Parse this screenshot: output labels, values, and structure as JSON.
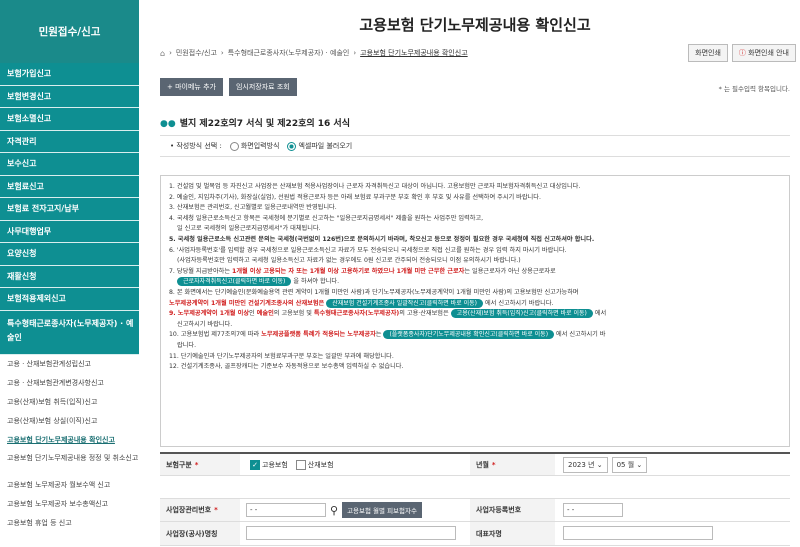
{
  "sidebar": {
    "title": "민원접수/신고",
    "items": [
      "보험가입신고",
      "보험변경신고",
      "보험소멸신고",
      "자격관리",
      "보수신고",
      "보험료신고",
      "보험료 전자고지/납부",
      "사무대행업무",
      "요양신청",
      "재활신청",
      "보험적용제외신고",
      "특수형태근로종사자(노무제공자) · 예술인"
    ],
    "subitems": [
      "고용 · 산재보험관계성립신고",
      "고용 · 산재보험관계변경사항신고",
      "고용(산재)보험 취득(입직)신고",
      "고용(산재)보험 상실(이직)신고",
      "고용보험 단기노무제공내용 확인신고",
      "고용보험 단기노무제공내용 정정 및 취소신고",
      "고용보험 노무제공자 월보수액 신고",
      "고용보험 노무제공자 보수총액신고",
      "고용보험 휴업 등 신고"
    ]
  },
  "header": {
    "title": "고용보험 단기노무제공내용 확인신고",
    "breadcrumb": [
      "민원접수/신고",
      "특수형태근로종사자(노무제공자) · 예술인",
      "고용보험 단기노무제공내용 확인신고"
    ],
    "print_label": "화면인쇄",
    "guide_label": "화면인쇄 안내"
  },
  "toolbar": {
    "add_menu": "+ 마이메뉴 추가",
    "temp_load": "임시저장자료 조회",
    "required_note": "* 는 필수입력 항목입니다."
  },
  "section": {
    "title": "별지 제22호의7 서식 및 제22호의 16 서식",
    "mode_label": "• 작성방식 선택 :",
    "mode_screen": "화면입력방식",
    "mode_excel": "엑셀파일 불러오기"
  },
  "notice": {
    "l1": "1. 건설업 및 벌목업 등 자진신고 사업장은 산재보험 적용사업장이나 근로자 자격취득신고 대상이 아닙니다. 고용보험만 근로자 피보험자격취득신고 대상입니다.",
    "l2": "2. 예술인, 지입차주(기사), 화장실(실업), 선원법 적용근로자 등은 아래 보험료 부과구분 부호 확인 후 부호 및 사유를 선택하여 주시기 바랍니다.",
    "l3": "3. 산재보험은 관리번호, 신고월별로 일용근로내역만 반영됩니다.",
    "l4": "4. 국세청 일용근로소득신고 항목은 국세청에 분기별로 신고하는 \"일용근로지급명세서\" 제출을 원하는 사업주만 입력하고,",
    "l4b": "일 신고로 국세청의 일용근로지급명세서\"가 대체됩니다.",
    "l5a": "5. 국세청 일용근로소득 신고관련 문의는 국세청(국번없이 126번)으로 문의하시기 바라며, 착오신고 등으로 정정이 필요한 경우 국세청에 직접 신고하셔야 합니다.",
    "l6": "6. '사업자등록번호'를 입력할 경우 국세청으로 일용근로소득신고 자료가 모두 전송되오니 국세청으로 직접 신고를 원하는 경우 입력 하지 마시기 바랍니다.",
    "l6b": "(사업자등록번호만 입력하고 국세청 일용소득신고 자료가 없는 경우에도 0원 신고로 간주되어 전송되오니 이점 유의하시기 바랍니다.)",
    "l7a": "7. 당당월 지급받아하는 ",
    "l7red": "1개월 이상 고용되는 자 또는 1개월 이상 고용하기로 하였으나 1개월 미만 근무한 근로자",
    "l7b": "는 일용근로자가 아닌 상용근로자로",
    "l7pill": "근로자자격취득신고(클릭하면 바로 이동)",
    "l7c": "을 하셔야 합니다.",
    "l8": "8. 본 화면에서는 단기예술인(문화예술용역 관련 계약이 1개월 미만인 사람)과 단기노무제공자(노무제공계약이 1개월 미만인 사람)의 고용보험만 신고가능하며",
    "l8red": "노무제공계약이 1개월 미만인 건설기계조종사의 산재보험은",
    "l8pill": "산재보험 건설기계조종사 일괄작신고(클릭하면 바로 이동)",
    "l8b": "에서 신고하시기 바랍니다.",
    "l9red": "9. 노무제공계약이 1개월 이상",
    "l9a": "인 ",
    "l9red2": "예술인",
    "l9b": "의 고용보험 및 ",
    "l9red3": "특수형태근로종사자(노무제공자)",
    "l9c": "의 고용·산재보험은",
    "l9pill": "고용(산재)보험 취득(입직)신고(클릭하면 바로 이동)",
    "l9d": "에서",
    "l9e": "신고하시기 바랍니다.",
    "l10a": "10. 고용보험법 제77조의7에 따라 ",
    "l10red": "노무제공플랫폼 특례가 적용되는 노무제공자",
    "l10b": "는",
    "l10pill": "(플랫폼종사자)단기노무제공내용 확인신고(클릭하면 바로 이동)",
    "l10c": "에서 신고하시기 바",
    "l10d": "랍니다.",
    "l11": "11. 단기예술인과 단기노무제공자의 보험료부과구분 부호는 일괄만 부과에 해당합니다.",
    "l12": "12. 건설기계조종사, 골프장캐디는 기준보수 자동적용으로 보수총액 입력하실 수 없습니다."
  },
  "form": {
    "insurance_label": "보험구분",
    "employment": "고용보험",
    "industrial": "산재보험",
    "year_month_label": "년월",
    "year": "2023 년",
    "month": "05 월",
    "mgmt_no_label": "사업장관리번호",
    "mgmt_no_value": "- -",
    "lookup_btn": "고용보험 월별 피보험자수",
    "biz_reg_label": "사업자등록번호",
    "biz_reg_value": "- -",
    "site_name_label": "사업장(공사)명칭",
    "rep_label": "대표자명"
  }
}
